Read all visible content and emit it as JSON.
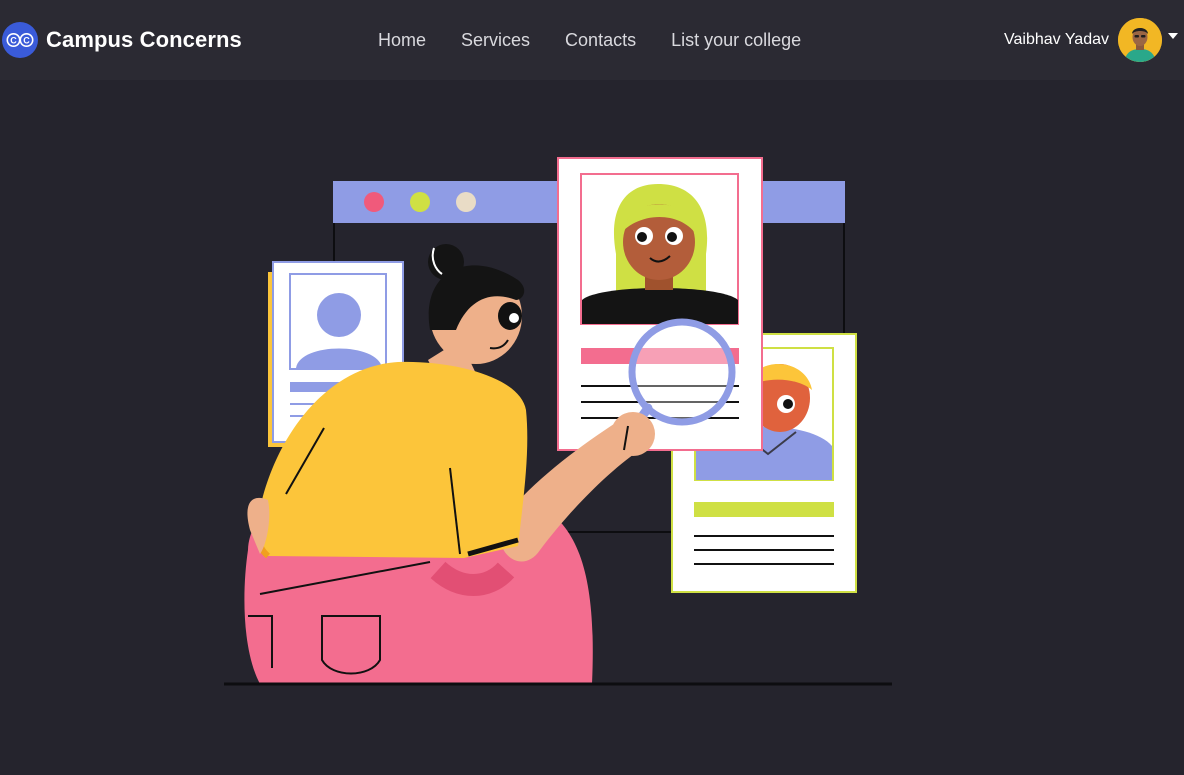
{
  "brand": {
    "logo_text": "CC",
    "name": "Campus Concerns"
  },
  "nav": {
    "links": [
      "Home",
      "Services",
      "Contacts",
      "List your college"
    ]
  },
  "user": {
    "name": "Vaibhav Yadav"
  },
  "colors": {
    "background": "#25242d",
    "navbar": "#2b2a33",
    "brand_logo": "#3a5bd9",
    "illustration_yellow": "#fcc53a",
    "illustration_pink": "#f36d8f",
    "illustration_lavender": "#8f9ce5",
    "illustration_lime": "#cfe044"
  },
  "icons": {
    "dropdown": "caret-down-icon",
    "magnifier": "magnifying-glass-icon"
  }
}
